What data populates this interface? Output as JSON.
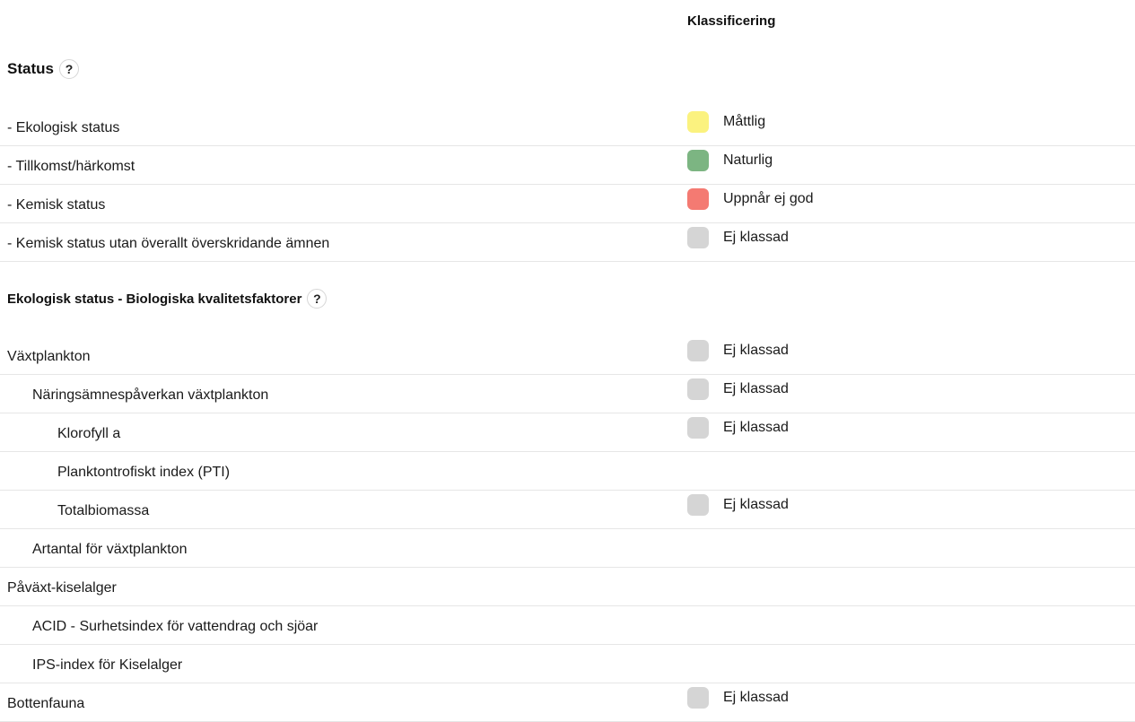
{
  "header": {
    "classification_label": "Klassificering"
  },
  "colors": {
    "mattlig": "#fbf27f",
    "naturlig": "#7cb582",
    "uppnar_ej_god": "#f47a72",
    "ej_klassad": "#d5d5d5"
  },
  "status_section": {
    "title": "Status",
    "help_label": "?",
    "rows": [
      {
        "label": "- Ekologisk status",
        "classification": "Måttlig"
      },
      {
        "label": "- Tillkomst/härkomst",
        "classification": "Naturlig"
      },
      {
        "label": "- Kemisk status",
        "classification": "Uppnår ej god"
      },
      {
        "label": "- Kemisk status utan överallt överskridande ämnen",
        "classification": "Ej klassad"
      }
    ]
  },
  "bio_section": {
    "title": "Ekologisk status - Biologiska kvalitetsfaktorer",
    "help_label": "?",
    "rows": [
      {
        "label": "Växtplankton",
        "classification": "Ej klassad"
      },
      {
        "label": "Näringsämnespåverkan växtplankton",
        "classification": "Ej klassad"
      },
      {
        "label": "Klorofyll a",
        "classification": "Ej klassad"
      },
      {
        "label": "Planktontrofiskt index (PTI)",
        "classification": ""
      },
      {
        "label": "Totalbiomassa",
        "classification": "Ej klassad"
      },
      {
        "label": "Artantal för växtplankton",
        "classification": ""
      },
      {
        "label": "Påväxt-kiselalger",
        "classification": ""
      },
      {
        "label": "ACID - Surhetsindex för vattendrag och sjöar",
        "classification": ""
      },
      {
        "label": "IPS-index för Kiselalger",
        "classification": ""
      },
      {
        "label": "Bottenfauna",
        "classification": "Ej klassad"
      }
    ]
  }
}
